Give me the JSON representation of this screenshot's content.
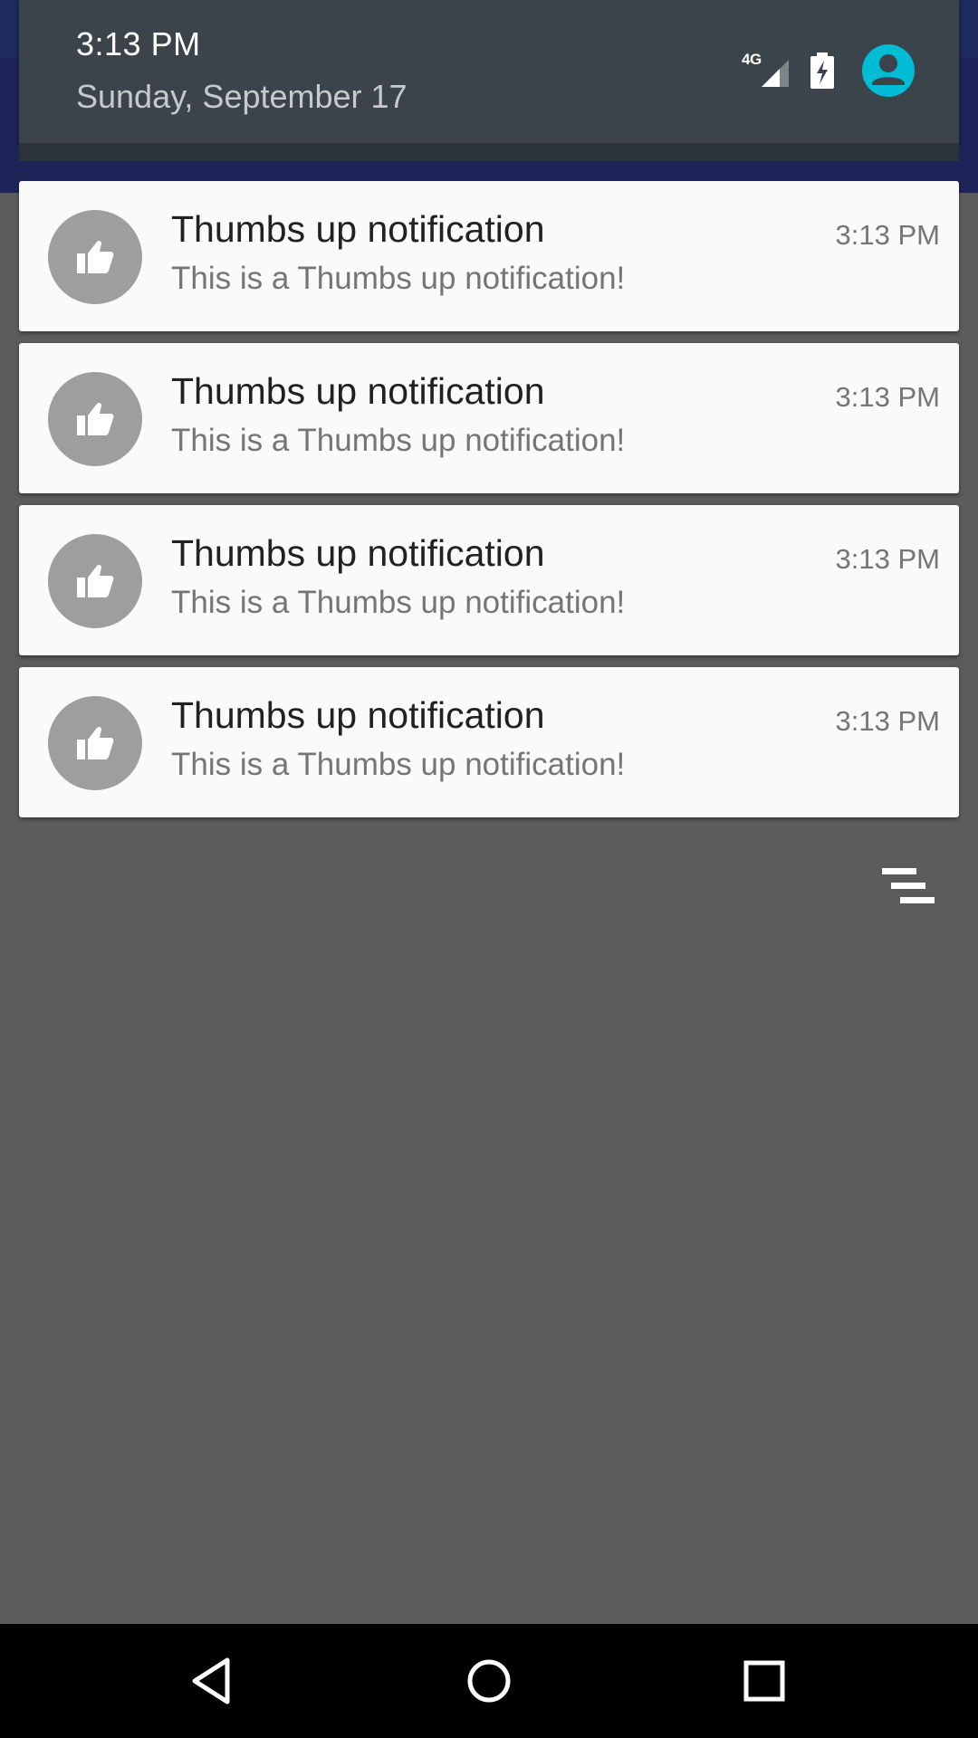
{
  "header": {
    "time": "3:13 PM",
    "date": "Sunday, September 17",
    "network_label": "4G",
    "icons": [
      "signal-icon",
      "battery-charging-icon",
      "account-icon"
    ],
    "accent_color": "#00bcd4"
  },
  "notifications": [
    {
      "title": "Thumbs up notification",
      "text": "This is a Thumbs up notification!",
      "time": "3:13 PM",
      "icon": "thumbs-up-icon"
    },
    {
      "title": "Thumbs up notification",
      "text": "This is a Thumbs up notification!",
      "time": "3:13 PM",
      "icon": "thumbs-up-icon"
    },
    {
      "title": "Thumbs up notification",
      "text": "This is a Thumbs up notification!",
      "time": "3:13 PM",
      "icon": "thumbs-up-icon"
    },
    {
      "title": "Thumbs up notification",
      "text": "This is a Thumbs up notification!",
      "time": "3:13 PM",
      "icon": "thumbs-up-icon"
    }
  ],
  "actions": {
    "clear_all_icon": "clear-all-icon"
  },
  "navbar": {
    "buttons": [
      "back-icon",
      "home-icon",
      "recents-icon"
    ]
  }
}
